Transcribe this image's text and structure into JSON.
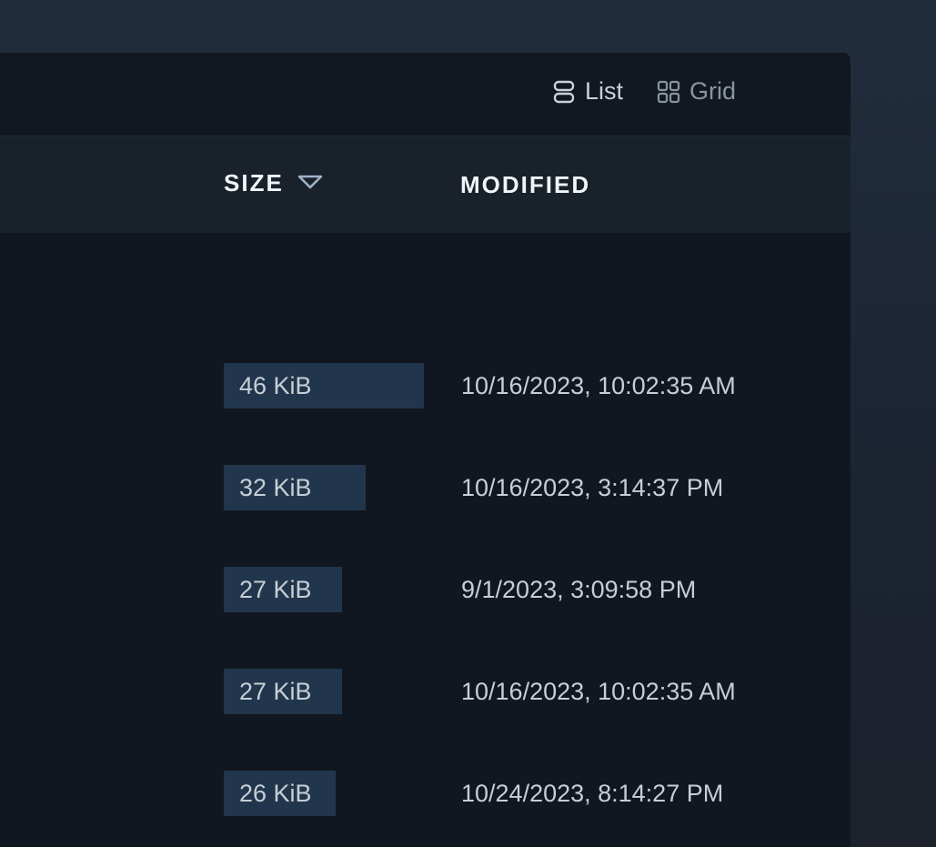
{
  "toolbar": {
    "list_label": "List",
    "grid_label": "Grid",
    "active_view": "list"
  },
  "columns": {
    "size_label": "SIZE",
    "size_sort": "descending",
    "modified_label": "MODIFIED"
  },
  "rows": [
    {
      "size": "46 KiB",
      "size_fraction": 1.0,
      "modified": "10/16/2023, 10:02:35 AM"
    },
    {
      "size": "32 KiB",
      "size_fraction": 0.71,
      "modified": "10/16/2023, 3:14:37 PM"
    },
    {
      "size": "27 KiB",
      "size_fraction": 0.59,
      "modified": "9/1/2023, 3:09:58 PM"
    },
    {
      "size": "27 KiB",
      "size_fraction": 0.59,
      "modified": "10/16/2023, 10:02:35 AM"
    },
    {
      "size": "26 KiB",
      "size_fraction": 0.56,
      "modified": "10/24/2023, 8:14:27 PM"
    }
  ],
  "colors": {
    "size_bar": "#21364c",
    "sort_indicator": "#9fb3c8"
  }
}
